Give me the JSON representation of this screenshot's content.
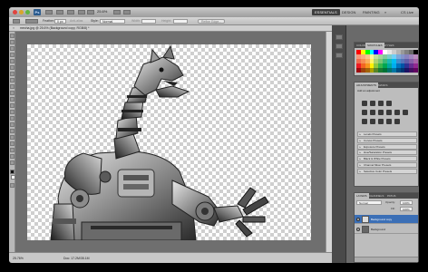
{
  "titlebar": {
    "logo": "Ps",
    "zoom": "25.6%",
    "workspaces": [
      "ESSENTIALS",
      "DESIGN",
      "PAINTING",
      "»"
    ],
    "active_workspace": "ESSENTIALS",
    "cs_live": "CS Live"
  },
  "options": {
    "feather_label": "Feather:",
    "feather_value": "0 px",
    "antialias": "Anti-alias",
    "style_label": "Style:",
    "style_value": "Normal",
    "width_label": "Width:",
    "height_label": "Height:",
    "refine_edge": "Refine Edge..."
  },
  "document": {
    "tab_title": "mecha.jpg @ 25.6% (Background copy, RGB/8) *",
    "close": "×"
  },
  "status": {
    "zoom": "25.76%",
    "doc_size": "Doc: 17.2M/35.1M"
  },
  "panels": {
    "color_tabs": [
      "COLOR",
      "SWATCHES",
      "STYLES"
    ],
    "active_color_tab": "SWATCHES",
    "adjust_tabs": [
      "ADJUSTMENTS",
      "MASKS"
    ],
    "active_adjust_tab": "ADJUSTMENTS",
    "adjust_heading": "Add an adjustment",
    "presets": [
      "Levels Presets",
      "Curves Presets",
      "Exposure Presets",
      "Hue/Saturation Presets",
      "Black & White Presets",
      "Channel Mixer Presets",
      "Selective Color Presets"
    ],
    "layers_tabs": [
      "LAYERS",
      "CHANNELS",
      "PATHS"
    ],
    "active_layers_tab": "LAYERS",
    "blend_mode": "Normal",
    "opacity_label": "Opacity:",
    "opacity_value": "100%",
    "fill_label": "Fill:",
    "fill_value": "100%",
    "layers": [
      {
        "name": "Background copy",
        "selected": true
      },
      {
        "name": "Background",
        "selected": false
      }
    ]
  },
  "colors": {
    "swatches": [
      "#ff0000",
      "#ffff00",
      "#00ff00",
      "#00ffff",
      "#0000ff",
      "#ff00ff",
      "#ffffff",
      "#e6e6e6",
      "#cccccc",
      "#b3b3b3",
      "#999999",
      "#808080",
      "#666666",
      "#000000",
      "#f7977a",
      "#f9ad81",
      "#fdc68a",
      "#fff79a",
      "#c4df9b",
      "#a2d39c",
      "#82ca9d",
      "#7bcdc8",
      "#6ecff6",
      "#7ea7d8",
      "#8493ca",
      "#8882be",
      "#a187be",
      "#bc8dbf",
      "#f26c4f",
      "#f68e55",
      "#fbaf5c",
      "#fff467",
      "#acd372",
      "#7cc576",
      "#3bb878",
      "#1abbb4",
      "#00bff3",
      "#438cca",
      "#5574b9",
      "#605ca8",
      "#855fa8",
      "#a763a8",
      "#ed1c24",
      "#f26522",
      "#f7941d",
      "#fff200",
      "#8dc73f",
      "#39b54a",
      "#00a651",
      "#00a99d",
      "#00aeef",
      "#0072bc",
      "#0054a6",
      "#2e3192",
      "#662d91",
      "#92278f",
      "#9e0b0f",
      "#a0410d",
      "#a3620a",
      "#aba000",
      "#598527",
      "#1a7b30",
      "#007236",
      "#00746b",
      "#0076a3",
      "#004b80",
      "#003471",
      "#1b1464",
      "#440e62",
      "#630460"
    ]
  }
}
